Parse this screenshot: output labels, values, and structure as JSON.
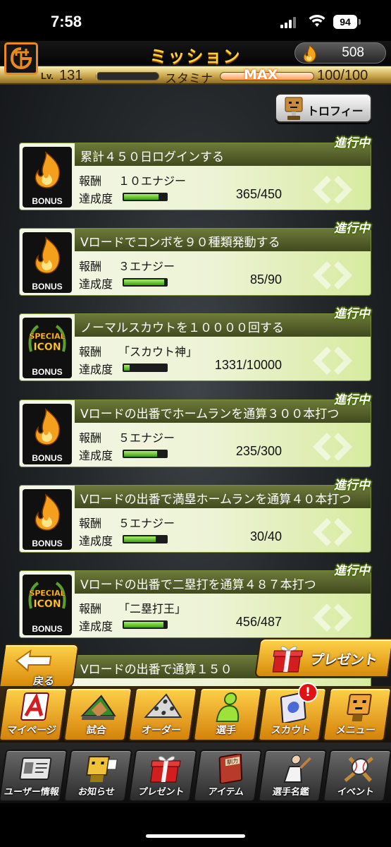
{
  "status_bar": {
    "time": "7:58",
    "battery": "94"
  },
  "header": {
    "title": "ミッション",
    "energy": "508"
  },
  "player": {
    "level_label": "Lv.",
    "level": "131",
    "stamina_label": "スタミナ",
    "stamina_max_badge": "MAX",
    "stamina": "100/100",
    "stamina_fraction": 1.0
  },
  "trophy_button": {
    "label": "トロフィー"
  },
  "missions": [
    {
      "status": "進行中",
      "title": "累計４５０日ログインする",
      "reward_label": "報酬",
      "reward": "１０エナジー",
      "progress_label": "達成度",
      "progress": "365/450",
      "fraction": 0.811,
      "icon": "energy-flame-icon",
      "badge": "BONUS"
    },
    {
      "status": "進行中",
      "title": "Vロードでコンボを９０種類発動する",
      "reward_label": "報酬",
      "reward": "３エナジー",
      "progress_label": "達成度",
      "progress": "85/90",
      "fraction": 0.944,
      "icon": "energy-flame-icon",
      "badge": "BONUS"
    },
    {
      "status": "進行中",
      "title": "ノーマルスカウトを１００００回する",
      "reward_label": "報酬",
      "reward": "「スカウト神」",
      "progress_label": "達成度",
      "progress": "1331/10000",
      "fraction": 0.133,
      "icon": "special-icon",
      "badge": "BONUS",
      "special_line1": "SPECIAL",
      "special_line2": "ICON"
    },
    {
      "status": "進行中",
      "title": "Vロードの出番でホームランを通算３００本打つ",
      "reward_label": "報酬",
      "reward": "５エナジー",
      "progress_label": "達成度",
      "progress": "235/300",
      "fraction": 0.783,
      "icon": "energy-flame-icon",
      "badge": "BONUS"
    },
    {
      "status": "進行中",
      "title": "Vロードの出番で満塁ホームランを通算４０本打つ",
      "reward_label": "報酬",
      "reward": "５エナジー",
      "progress_label": "達成度",
      "progress": "30/40",
      "fraction": 0.75,
      "icon": "energy-flame-icon",
      "badge": "BONUS"
    },
    {
      "status": "進行中",
      "title": "Vロードの出番で二塁打を通算４８７本打つ",
      "reward_label": "報酬",
      "reward": "「二塁打王」",
      "progress_label": "達成度",
      "progress": "456/487",
      "fraction": 0.936,
      "icon": "special-icon",
      "badge": "BONUS",
      "special_line1": "SPECIAL",
      "special_line2": "ICON"
    },
    {
      "status": "",
      "title": "Vロードの出番で通算１５０",
      "reward_label": "",
      "reward": "",
      "progress_label": "",
      "progress": "",
      "fraction": 0,
      "icon": "energy-flame-icon",
      "badge": ""
    }
  ],
  "back_button": {
    "label": "戻る"
  },
  "present_button": {
    "label": "プレゼント"
  },
  "nav_primary": [
    {
      "label": "マイページ",
      "icon": "my-page-icon"
    },
    {
      "label": "試合",
      "icon": "game-icon"
    },
    {
      "label": "オーダー",
      "icon": "order-icon"
    },
    {
      "label": "選手",
      "icon": "player-icon"
    },
    {
      "label": "スカウト",
      "icon": "scout-icon",
      "badge": "!"
    },
    {
      "label": "メニュー",
      "icon": "menu-icon"
    }
  ],
  "nav_secondary": [
    {
      "label": "ユーザー情報",
      "icon": "user-info-icon"
    },
    {
      "label": "お知らせ",
      "icon": "news-icon"
    },
    {
      "label": "プレゼント",
      "icon": "present-icon"
    },
    {
      "label": "アイテム",
      "icon": "item-icon",
      "book_text": "馴力"
    },
    {
      "label": "選手名鑑",
      "icon": "player-directory-icon"
    },
    {
      "label": "イベント",
      "icon": "event-icon"
    }
  ],
  "colors": {
    "accent_gold": "#ffd23a",
    "progress_green": "#3fa013",
    "status_outline": "#4d6f0a",
    "card_title_bg": "#4e5a28",
    "notif_red": "#e21212"
  }
}
